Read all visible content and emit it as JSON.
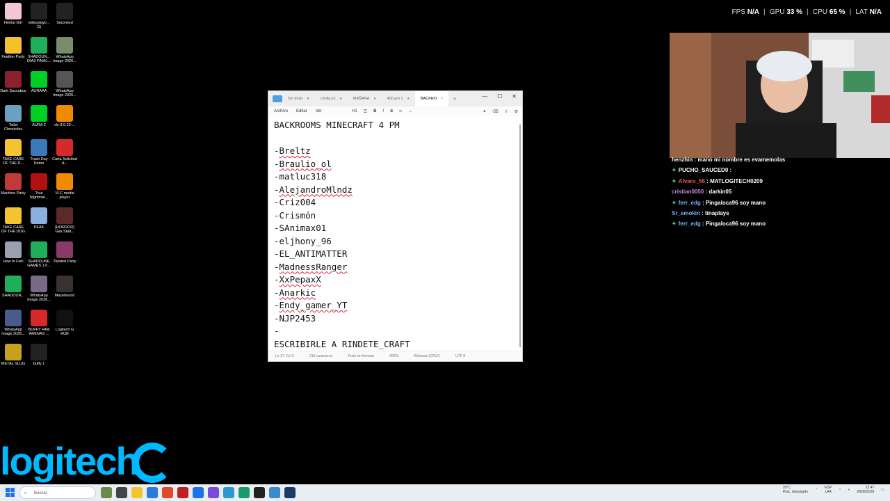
{
  "stats": {
    "fps_label": "FPS",
    "fps_value": "N/A",
    "gpu_label": "GPU",
    "gpu_value": "33 %",
    "cpu_label": "CPU",
    "cpu_value": "65 %",
    "lat_label": "LAT",
    "lat_value": "N/A"
  },
  "desktop_icons": [
    {
      "label": "Hentai Girl",
      "color": "#f3c6d6"
    },
    {
      "label": "videoplayb... (1)",
      "color": "#222222"
    },
    {
      "label": "Surprised",
      "color": "#222222"
    },
    {
      "label": "Feather Party",
      "color": "#f5c02a"
    },
    {
      "label": "SHADOUN... DIA3 FINAL...",
      "color": "#1fae5a"
    },
    {
      "label": "WhatsApp Image 2026...",
      "color": "#7a8c6a"
    },
    {
      "label": "Dark Succubus",
      "color": "#8a2030"
    },
    {
      "label": "AURAAA",
      "color": "#00d026"
    },
    {
      "label": "WhatsApp Image 2026...",
      "color": "#555555"
    },
    {
      "label": "Toilet Chronicles",
      "color": "#6aa0c0"
    },
    {
      "label": "AURA 2",
      "color": "#00d026"
    },
    {
      "label": "vlc-3.0.23-...",
      "color": "#f08a00"
    },
    {
      "label": "TAKE CARE OF THE D...",
      "color": "#f4c430"
    },
    {
      "label": "Trash Day Demo",
      "color": "#3a7ab8"
    },
    {
      "label": "Carta Solicitud A...",
      "color": "#d62a2a"
    },
    {
      "label": "Machine Party",
      "color": "#c03a3a"
    },
    {
      "label": "True Nightmar...",
      "color": "#b01010"
    },
    {
      "label": "VLC media player",
      "color": "#f08a00"
    },
    {
      "label": "TAKE CARE OF THE DOG",
      "color": "#f4c430"
    },
    {
      "label": "PEAK",
      "color": "#8ab0e0"
    },
    {
      "label": "[HORROR] Gas Stati...",
      "color": "#5a2a2a"
    },
    {
      "label": "How to Fish",
      "color": "#9aa0b0"
    },
    {
      "label": "SHADOUNE GAMES 1.0...",
      "color": "#1fae5a"
    },
    {
      "label": "Twisted Party",
      "color": "#8a3a6a"
    },
    {
      "label": "SHADOUN...",
      "color": "#1fae5a"
    },
    {
      "label": "WhatsApp Image 2026...",
      "color": "#7a6a8a"
    },
    {
      "label": "Mazebound",
      "color": "#3a3030"
    },
    {
      "label": "WhatsApp Image 2026...",
      "color": "#4a5a8a"
    },
    {
      "label": "BUFFY FAM ARENAS ...",
      "color": "#d62a2a"
    },
    {
      "label": "Logitech G HUB",
      "color": "#111111"
    },
    {
      "label": "METAL SLUG",
      "color": "#c8a020"
    },
    {
      "label": "buffy 1",
      "color": "#222222"
    }
  ],
  "brand": {
    "text": "logitech"
  },
  "chat": [
    {
      "user": "henzhin",
      "color": "#ffffff",
      "star": false,
      "msg": "mano mi nombre es evamemolas"
    },
    {
      "user": "PUCHO_SAUCED0",
      "color": "#ffffff",
      "star": true,
      "msg": ""
    },
    {
      "user": "Alvaro_56",
      "color": "#e05a5a",
      "star": true,
      "msg": "MATLOGITECH0209"
    },
    {
      "user": "cristian0050",
      "color": "#c08ae0",
      "star": false,
      "msg": "darkin05"
    },
    {
      "user": "ferr_edg",
      "color": "#7ab0ff",
      "star": true,
      "msg": "Pingaloca96 soy mano"
    },
    {
      "user": "Sr_smokin",
      "color": "#7ab0ff",
      "star": false,
      "msg": "tinaplays"
    },
    {
      "user": "ferr_edg",
      "color": "#7ab0ff",
      "star": true,
      "msg": "Pingaloca96 soy mano"
    }
  ],
  "notepad": {
    "tabs": [
      {
        "label": "Sin título",
        "active": false
      },
      {
        "label": "config.ini",
        "active": false
      },
      {
        "label": "MAÑANA",
        "active": false
      },
      {
        "label": "400 pm 1",
        "active": false
      },
      {
        "label": "BACKRO",
        "active": true
      }
    ],
    "menu": {
      "file": "Archivo",
      "edit": "Editar",
      "view": "Ver",
      "heading": "H1"
    },
    "lines": [
      {
        "text": "BACKROOMS MINECRAFT 4 PM",
        "squiggle": false
      },
      {
        "text": "",
        "squiggle": false
      },
      {
        "text": "-Breltz",
        "squiggle": true
      },
      {
        "text": "-Braulio_ol",
        "squiggle": true
      },
      {
        "text": "-matluc318",
        "squiggle": false
      },
      {
        "text": "-AlejandroMlndz",
        "squiggle": true
      },
      {
        "text": "-Criz004",
        "squiggle": false
      },
      {
        "text": "-Crismón",
        "squiggle": false
      },
      {
        "text": "-SAnimax01",
        "squiggle": false
      },
      {
        "text": "-eljhony_96",
        "squiggle": false
      },
      {
        "text": "-EL_ANTIMATTER",
        "squiggle": false
      },
      {
        "text": "-MadnessRanger",
        "squiggle": true
      },
      {
        "text": "-XxPepaxX",
        "squiggle": true
      },
      {
        "text": "-Anarkic",
        "squiggle": true
      },
      {
        "text": "-Endy_gamer_YT",
        "squiggle": true
      },
      {
        "text": "-NJP2453",
        "squiggle": false
      },
      {
        "text": "-",
        "squiggle": false
      },
      {
        "text": "ESCRIBIRLE A RINDETE_CRAFT",
        "squiggle": false
      }
    ],
    "status": {
      "position": "Ln 17, Col 2",
      "chars": "215 caracteres",
      "format": "Texto sin formato",
      "zoom": "200%",
      "eol": "Windows (CRLF)",
      "encoding": "UTF-8"
    }
  },
  "taskbar": {
    "search_placeholder": "Buscar",
    "weather_temp": "20°C",
    "weather_desc": "Prac. despejado",
    "lang_top": "ESP",
    "lang_bottom": "LAA",
    "time": "22:47",
    "date": "28/08/2026",
    "app_colors": [
      "#6a8a4a",
      "#444444",
      "#f4c430",
      "#2a7ae0",
      "#e04a2a",
      "#c02020",
      "#1a73e8",
      "#7a4ae0",
      "#2a9ad0",
      "#1a9a6a",
      "#222222",
      "#3a8ad0",
      "#1a3a6a"
    ]
  }
}
